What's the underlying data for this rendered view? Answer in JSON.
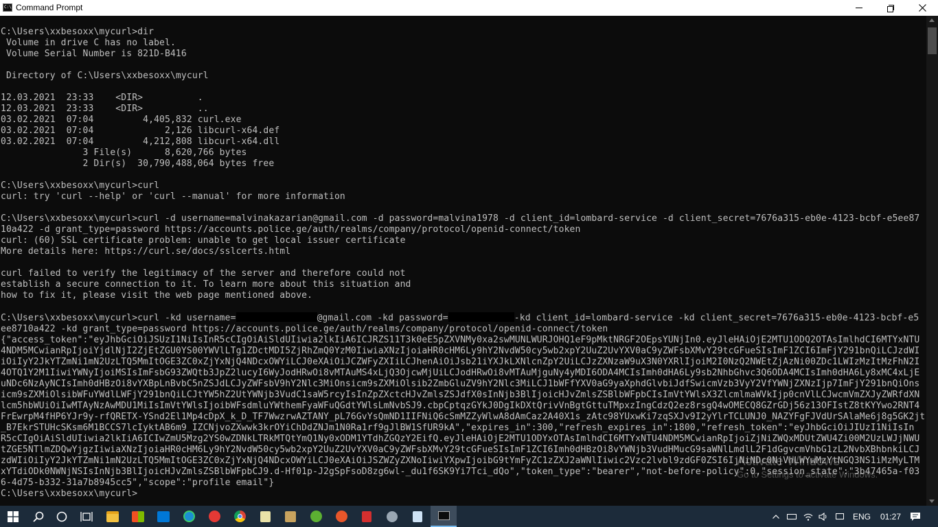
{
  "window": {
    "title": "Command Prompt",
    "icon_label": "C:\\"
  },
  "console": {
    "lines": [
      "C:\\Users\\xxbesoxx\\mycurl>dir",
      " Volume in drive C has no label.",
      " Volume Serial Number is 821D-B416",
      "",
      " Directory of C:\\Users\\xxbesoxx\\mycurl",
      "",
      "12.03.2021  23:33    <DIR>          .",
      "12.03.2021  23:33    <DIR>          ..",
      "03.02.2021  07:04         4,405,832 curl.exe",
      "03.02.2021  07:04             2,126 libcurl-x64.def",
      "03.02.2021  07:04         4,212,808 libcurl-x64.dll",
      "               3 File(s)      8,620,766 bytes",
      "               2 Dir(s)  30,790,488,064 bytes free",
      "",
      "C:\\Users\\xxbesoxx\\mycurl>curl",
      "curl: try 'curl --help' or 'curl --manual' for more information",
      "",
      "C:\\Users\\xxbesoxx\\mycurl>curl -d username=malvinakazarian@gmail.com -d password=malvina1978 -d client_id=lombard-service -d client_secret=7676a315-eb0e-4123-bcbf-e5ee87",
      "10a422 -d grant_type=password https://accounts.police.ge/auth/realms/company/protocol/openid-connect/token",
      "curl: (60) SSL certificate problem: unable to get local issuer certificate",
      "More details here: https://curl.se/docs/sslcerts.html",
      "",
      "curl failed to verify the legitimacy of the server and therefore could not",
      "establish a secure connection to it. To learn more about this situation and",
      "how to fix it, please visit the web page mentioned above.",
      "",
      "C:\\Users\\xxbesoxx\\mycurl>curl -kd username=@@REDACT1@@@gmail.com -kd password=@@REDACT2@@-kd client_id=lombard-service -kd client_secret=7676a315-eb0e-4123-bcbf-e5",
      "ee8710a422 -kd grant_type=password https://accounts.police.ge/auth/realms/company/protocol/openid-connect/token",
      "{\"access_token\":\"eyJhbGciOiJSUzI1NiIsInR5cCIgOiAiSldUIiwia2lkIiA6ICJRZS11T3k0eE5pZXVNMy0xa2swMUNLWURJOHQ1eF9pMktNRGF2OEpsYUNjIn0.eyJleHAiOjE2MTU1ODQ2OTAsImlhdCI6MTYxNTU",
      "4NDM5MCwianRpIjoiYjdlNjI2ZjEtZGU0YS00YWVlLTg1ZDctMDI5ZjRhZmQ0YzM0IiwiaXNzIjoiaHR0cHM6Ly9hY2NvdW50cy5wb2xpY2UuZ2UvYXV0aC9yZWFsbXMvY29tcGFueSIsImF1ZCI6ImFjY291bnQiLCJzdWI",
      "iOiIyY2JkYTZmNi1mN2UzLTQ5MmItOGE3ZC0xZjYxNjQ4NDcxOWYiLCJ0eXAiOiJCZWFyZXIiLCJhenAiOiJsb21iYXJkLXNlcnZpY2UiLCJzZXNzaW9uX3N0YXRlIjoiM2I0NzQ2NWEtZjAzNi00ZDc1LWIzMzItMzFhN2I",
      "4OTQ1Y2M1IiwiYWNyIjoiMSIsImFsbG93ZWQtb3JpZ2lucyI6WyJodHRwOi8vMTAuMS4xLjQ3OjcwMjUiLCJodHRwOi8vMTAuMjguNy4yMDI6ODA4MCIsImh0dHA6Ly9sb2NhbGhvc3Q6ODA4MCIsImh0dHA6Ly8xMC4xLjE",
      "uNDc6NzAyNCIsImh0dHBzOi8vYXBpLnBvbC5nZSJdLCJyZWFsbV9hY2Nlc3MiOnsicm9sZXMiOlsib2ZmbGluZV9hY2Nlc3MiLCJ1bWFfYXV0aG9yaXphdGlvbiJdfSwicmVzb3VyY2VfYWNjZXNzIjp7ImFjY291bnQiOns",
      "icm9sZXMiOlsibWFuYWdlLWFjY291bnQiLCJtYW5hZ2UtYWNjb3VudC1saW5rcyIsInZpZXctcHJvZmlsZSJdfX0sInNjb3BlIjoicHJvZmlsZSBlbWFpbCIsImVtYWlsX3ZlcmlmaWVkIjp0cnVlLCJwcmVmZXJyZWRfdXN",
      "lcm5hbWUiOiIwMTAyNzAwMDU1MiIsImVtYWlsIjoibWFsdmluYWthemFyaWFuQGdtYWlsLmNvbSJ9.cbpCptqzGYkJ0DgIkDXtQrivVnBgtGttuTMpxzIngCdzQ2ez8rsgQ4wOMECQ8GZrGDj56z13OFIstZ8tKYYwo2RNT4",
      "FrEwrpM4fHP6YJr9y-rfQRETX-YSnd2El1Mp4cDpX_k_D_TF7WwzrwAZTANY_pL76GvYsQmND1IIFNiQ6cSmMZZyWlwA8dAmCaz2A40X1s_zAtc98YUxwKi7zqSXJv9I2yYlrTCLUNJ0_NAZYFgFJVdUrSAlaMe6j8g5GK2jt",
      "_B7EkrSTUHcSKsm6M1BCCS7lcIyktAB6m9_IZCNjvoZXwwk3krOYiChDdZNJm1N0Ra1rf9gJlBW1SfUR9kA\",\"expires_in\":300,\"refresh_expires_in\":1800,\"refresh_token\":\"eyJhbGciOiJIUzI1NiIsIn",
      "R5cCIgOiAiSldUIiwia2lkIiA6ICIwZmU5Mzg2YS0wZDNkLTRkMTQtYmQ1Ny0xODM1YTdhZGQzY2EifQ.eyJleHAiOjE2MTU1ODYxOTAsImlhdCI6MTYxNTU4NDM5MCwianRpIjoiZjNiZWQxMDUtZWU4Zi00M2UzLWJjNWU",
      "tZGE5NTlmZDQwYjgzIiwiaXNzIjoiaHR0cHM6Ly9hY2NvdW50cy5wb2xpY2UuZ2UvYXV0aC9yZWFsbXMvY29tcGFueSIsImF1ZCI6Imh0dHBzOi8vYWNjb3VudHMucG9saWNlLmdlL2F1dGgvcmVhbG1zL2NvbXBhbnkiLCJ",
      "zdWIiOiIyY2JkYTZmNi1mN2UzLTQ5MmItOGE3ZC0xZjYxNjQ4NDcxOWYiLCJ0eXAiOiJSZWZyZXNoIiwiYXpwIjoibG9tYmFyZC1zZXJ2aWNlIiwic2Vzc2lvbl9zdGF0ZSI6IjNiNDc0NjVhLWYwMzYtNGQ3NS1iMzMyLTM",
      "xYTdiODk0NWNjNSIsInNjb3BlIjoicHJvZmlsZSBlbWFpbCJ9.d-Hf01p-J2gSpFsoD8zg6wl-_du1f6SK9Yi7Tci_dQo\",\"token_type\":\"bearer\",\"not-before-policy\":0,\"session_state\":\"3b47465a-f03",
      "6-4d75-b332-31a7b8945cc5\",\"scope\":\"profile email\"}",
      "C:\\Users\\xxbesoxx\\mycurl>"
    ]
  },
  "watermark": {
    "title": "Activate Windows",
    "subtitle": "Go to Settings to activate Windows."
  },
  "taskbar": {
    "language": "ENG",
    "clock": "01:27",
    "accent": "#76b9ed",
    "background": "#1c2b3a"
  }
}
